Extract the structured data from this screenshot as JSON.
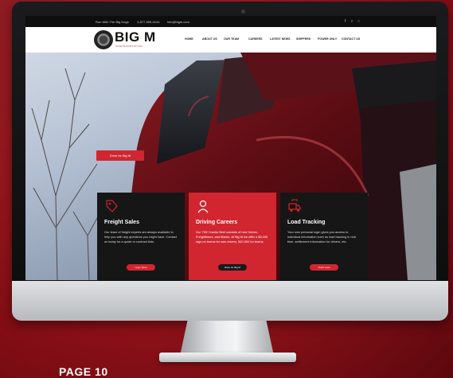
{
  "site": {
    "topbar": {
      "phone_label": "Run With The Big Dogs",
      "phone": "1-877-555-0144",
      "email": "info@bigm.com",
      "social_icons": [
        "facebook-icon",
        "twitter-icon",
        "instagram-icon"
      ]
    },
    "logo": {
      "text": "BIG M",
      "subtitle": "TRANSPORTATION"
    },
    "nav": [
      "HOME",
      "ABOUT US",
      "OUR TEAM",
      "CAREERS",
      "LATEST NEWS",
      "SHIPPERS",
      "POWER ONLY",
      "CONTACT US"
    ],
    "hero_button": "Drive for Big M",
    "cards": [
      {
        "title": "Freight Sales",
        "body": "Our team of freight experts are always available to help you with any questions you might have. Contact us today for a quote or contract bids.",
        "button": "Learn More",
        "icon": "tag-icon",
        "accent": "#161616"
      },
      {
        "title": "Driving Careers",
        "body": "Our 700+ tractor fleet consists of new Volvos, Freightliners, and Macks. At Big M we offer a $5,000 sign-on bonus for solo drivers, $10,000 for teams.",
        "button": "Drive for Big M",
        "icon": "driver-icon",
        "accent": "#d12630"
      },
      {
        "title": "Load Tracking",
        "body": "Your own personal login gives you access to individual information such as load tracking in real time, settlement information for drivers, etc.",
        "button": "Track Load",
        "icon": "truck-icon",
        "accent": "#161616"
      }
    ]
  },
  "page_label": "PAGE 10",
  "colors": {
    "brand_red": "#d12630",
    "background": "#a3141d"
  }
}
